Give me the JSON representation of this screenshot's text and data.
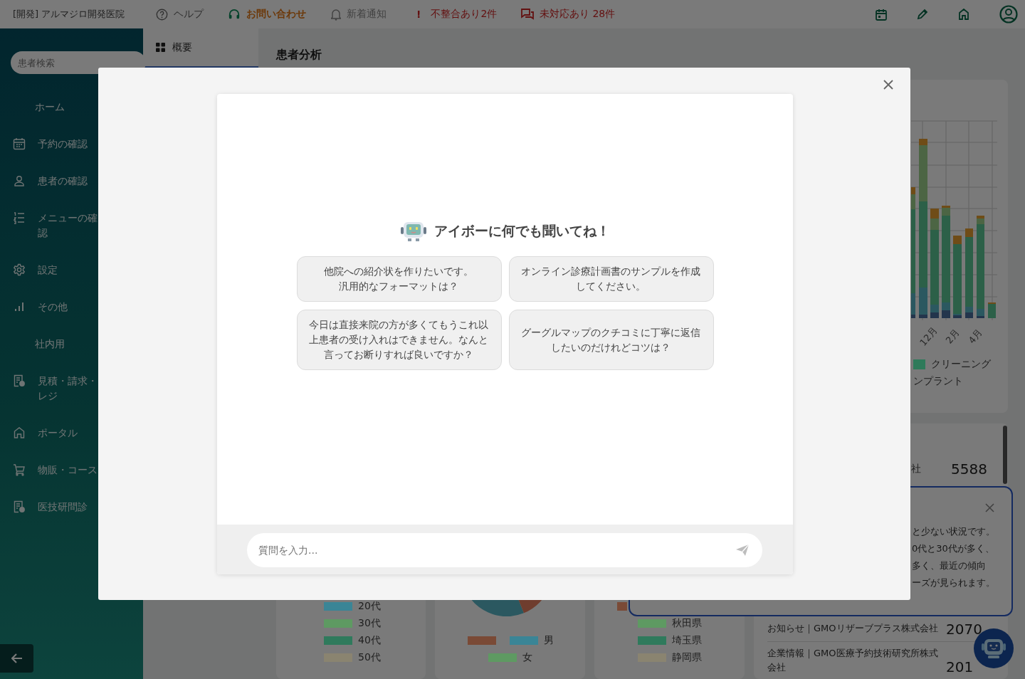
{
  "header": {
    "clinic": "[開発] アルマジロ開発医院",
    "links": [
      {
        "kind": "help",
        "label": "ヘルプ"
      },
      {
        "kind": "contact",
        "label": "お問い合わせ"
      },
      {
        "kind": "notice",
        "label": "新着通知"
      },
      {
        "kind": "alert",
        "mark": "!",
        "label": "不整合あり2件"
      },
      {
        "kind": "pending",
        "label": "未対応あり 28件"
      }
    ]
  },
  "sidebar": {
    "search_placeholder": "患者検索",
    "items": [
      {
        "kind": "header",
        "label": "ホーム"
      },
      {
        "kind": "link",
        "label": "予約の確認"
      },
      {
        "kind": "link",
        "label": "患者の確認"
      },
      {
        "kind": "link",
        "label": "メニューの確認"
      },
      {
        "kind": "link",
        "label": "設定"
      },
      {
        "kind": "link",
        "label": "その他"
      },
      {
        "kind": "header",
        "label": "社内用"
      },
      {
        "kind": "link",
        "label": "見積・請求・レジ"
      },
      {
        "kind": "link",
        "label": "ポータル"
      },
      {
        "kind": "link",
        "label": "物販・コース"
      },
      {
        "kind": "link",
        "label": "医技研問診"
      }
    ]
  },
  "tabs": [
    {
      "label": "概要"
    }
  ],
  "page_title": "患者分析",
  "chart": {
    "month_labels": [
      "12月",
      "2月",
      "4月"
    ],
    "legend": [
      {
        "label": "クリーニング",
        "color": "#2e7a5a"
      },
      {
        "label": "ンプラント"
      }
    ]
  },
  "age_legend": [
    {
      "label": "20代",
      "color": "#3a8596"
    },
    {
      "label": "30代",
      "color": "#5e9a62"
    },
    {
      "label": "40代",
      "color": "#2f7a5c"
    },
    {
      "label": "50代",
      "color": "#8a8470"
    }
  ],
  "gender_legend": [
    {
      "color": "#7a4a36"
    },
    {
      "label": "男",
      "color": "#3a8596"
    },
    {
      "label": "女",
      "color": "#5e9a62"
    }
  ],
  "region_legend": [
    {
      "color": "#7a4a36"
    },
    {
      "label": "秋田県",
      "color": "#5e9a62"
    },
    {
      "label": "埼玉県",
      "color": "#2f7a5c"
    },
    {
      "label": "静岡県",
      "color": "#8a8470"
    }
  ],
  "news": {
    "stat": {
      "label": "社",
      "value": "5588"
    },
    "items": [
      {
        "label": "お知らせ｜GMOリザーブプラス株式会社",
        "value": "2070"
      },
      {
        "label": "企業情報｜GMO医療予約技術研究所株式会社",
        "value": "201"
      }
    ]
  },
  "popup": {
    "lines": [
      "と少ない状況です。",
      "0代と30代が多く、",
      "多く、最近の傾向",
      "ーズが見られます。"
    ]
  },
  "modal": {
    "title": "アイボーに何でも聞いてね！",
    "suggestions": [
      "他院への紹介状を作りたいです。汎用的なフォーマットは？",
      "オンライン診療計画書のサンプルを作成してください。",
      "今日は直接来院の方が多くてもうこれ以上患者の受け入れはできません。なんと言ってお断りすれば良いですか？",
      "グーグルマップのクチコミに丁寧に返信したいのだけれどコツは？"
    ],
    "input_placeholder": "質問を入力..."
  }
}
